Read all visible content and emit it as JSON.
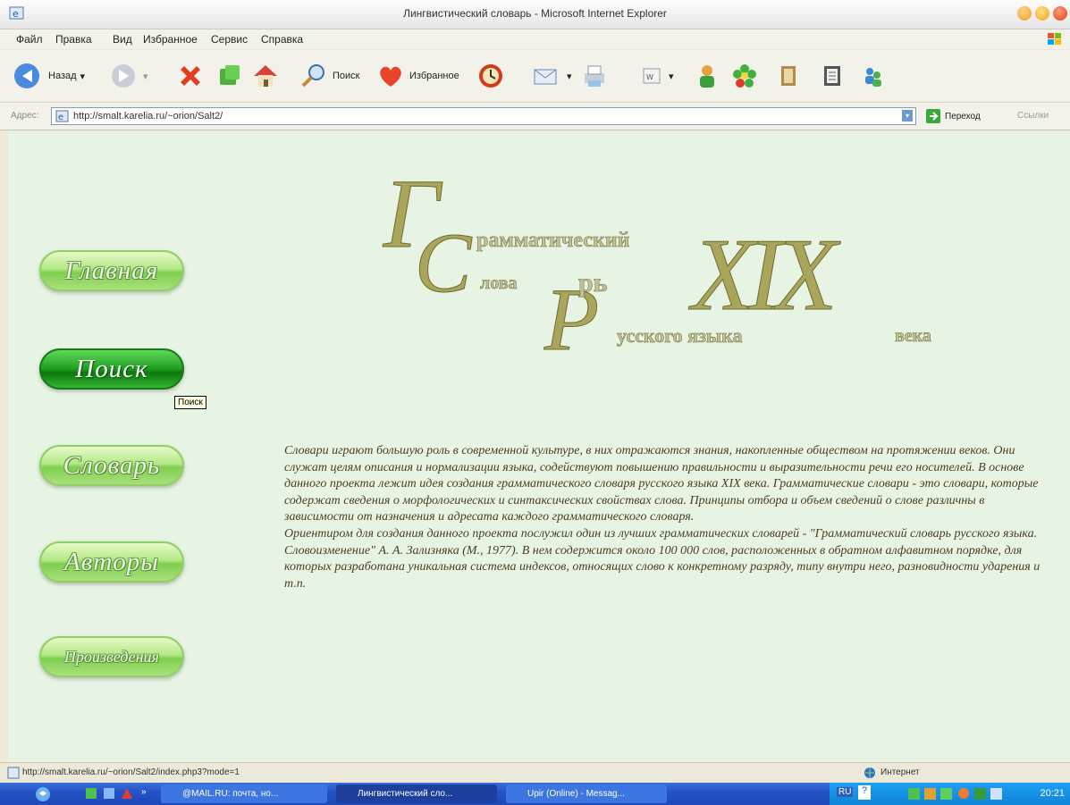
{
  "window": {
    "title": "Лингвистический словарь - Microsoft Internet Explorer",
    "colors": {
      "title_bg": "#f2f2f2",
      "content_bg": "#e7f3e3",
      "accent_green": "#1f9e1f",
      "text_brown": "#4a3f22",
      "logo_olive": "#a9a55a"
    }
  },
  "menu": {
    "items": [
      "Файл",
      "Правка",
      "Вид",
      "Избранное",
      "Сервис",
      "Справка"
    ]
  },
  "toolbar": {
    "back_label": "Назад",
    "search_label": "Поиск",
    "favorites_label": "Избранное"
  },
  "address": {
    "label": "Адрес:",
    "url": "http://smalt.karelia.ru/~orion/Salt2/",
    "go_label": "Переход",
    "links_label": "Ссылки"
  },
  "nav": {
    "items": [
      "Главная",
      "Поиск",
      "Словарь",
      "Авторы",
      "Произведения"
    ],
    "active_index": 1,
    "tooltip": "Поиск"
  },
  "logo": {
    "big_g": "Г",
    "line1": "рамматический",
    "big_c": "С",
    "line2": "лова",
    "line2b": "рь",
    "big_r": "Р",
    "line3": "усского языка",
    "roman": "XIX",
    "line4": "века"
  },
  "intro": {
    "para1": "Словари играют большую роль в современной культуре, в них отражаются знания, накопленные обществом на протяжении веков. Они служат целям описания и нормализации языка, содействуют повышению правильности и выразительности речи его носителей. В основе данного проекта лежит идея создания грамматического словаря русского языка XIX века. Грамматические словари - это словари, которые содержат сведения о морфологических и синтаксических свойствах слова. Принципы отбора и объем сведений о слове различны в зависимости от назначения и адресата каждого грамматического словаря.",
    "para2": "Ориентиром для создания данного проекта послужил один из лучших грамматических словарей - \"Грамматический словарь русского языка. Словоизменение\" А. А. Зализняка (М., 1977). В нем содержится около 100 000 слов, расположенных в обратном алфавитном порядке, для которых разработана уникальная система индексов, относящих слово к конкретному разряду, типу внутри него, разновидности ударения и т.п."
  },
  "status": {
    "url": "http://smalt.karelia.ru/~orion/Salt2/index.php3?mode=1",
    "zone": "Интернет"
  },
  "taskbar": {
    "tasks": [
      "@MAIL.RU: почта, но...",
      "Лингвистический сло...",
      "Upir (Online) - Messag..."
    ],
    "clock": "20:21",
    "lang": "RU"
  }
}
